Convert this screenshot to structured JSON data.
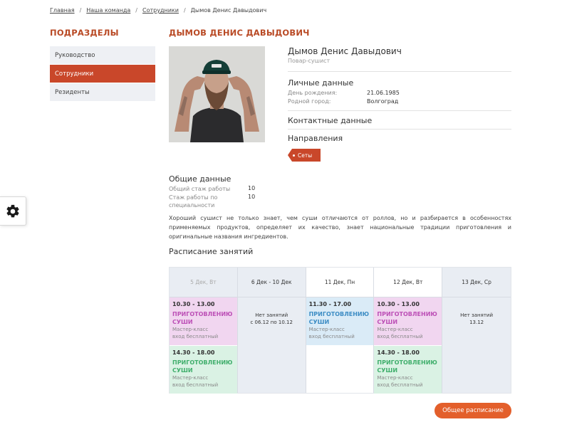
{
  "breadcrumb": {
    "items": [
      "Главная",
      "Наша команда",
      "Сотрудники"
    ],
    "current": "Дымов Денис Давыдович",
    "separator": "/"
  },
  "sidebar": {
    "title": "ПОДРАЗДЕЛЫ",
    "items": [
      {
        "label": "Руководство",
        "active": false
      },
      {
        "label": "Сотрудники",
        "active": true
      },
      {
        "label": "Резиденты",
        "active": false
      }
    ]
  },
  "profile": {
    "heading": "ДЫМОВ ДЕНИС ДАВЫДОВИЧ",
    "name": "Дымов Денис Давыдович",
    "role": "Повар-сушист",
    "personal": {
      "title": "Личные данные",
      "birthday_label": "День рождения:",
      "birthday_value": "21.06.1985",
      "city_label": "Родной город:",
      "city_value": "Волгоград"
    },
    "contacts_title": "Контактные данные",
    "directions_title": "Направления",
    "directions": [
      "Сеты"
    ],
    "general": {
      "title": "Общие данные",
      "total_label": "Общий стаж работы",
      "total_value": "10",
      "spec_label": "Стаж работы по специальности",
      "spec_value": "10"
    },
    "description": "Хороший сушист не только знает, чем суши отличаются от роллов, но и разбирается в особенностях применяемых продуктов, определяет их качество, знает национальные традиции приготовления и оригинальные названия ингредиентов."
  },
  "schedule": {
    "title": "Расписание занятий",
    "columns": [
      {
        "header": "5 Дек, Вт",
        "muted": true
      },
      {
        "header": "6 Дек - 10 Дек",
        "empty_line1": "Нет занятий",
        "empty_line2": "с 06.12 по 10.12"
      },
      {
        "header": "11 Дек, Пн"
      },
      {
        "header": "12 Дек, Вт"
      },
      {
        "header": "13 Дек, Ср",
        "empty_line1": "Нет занятий",
        "empty_line2": "13.12"
      }
    ],
    "events": {
      "c1_e1": {
        "time": "10.30 - 13.00",
        "name": "ПРИГОТОВЛЕНИЮ СУШИ",
        "kind": "Мастер-класс",
        "price": "вход бесплатный"
      },
      "c1_e2": {
        "time": "14.30 - 18.00",
        "name": "ПРИГОТОВЛЕНИЮ СУШИ",
        "kind": "Мастер-класс",
        "price": "вход бесплатный"
      },
      "c3_e1": {
        "time": "11.30 - 17.00",
        "name": "ПРИГОТОВЛЕНИЮ СУШИ",
        "kind": "Мастер-класс",
        "price": "вход бесплатный"
      },
      "c4_e1": {
        "time": "10.30 - 13.00",
        "name": "ПРИГОТОВЛЕНИЮ СУШИ",
        "kind": "Мастер-класс",
        "price": "вход бесплатный"
      },
      "c4_e2": {
        "time": "14.30 - 18.00",
        "name": "ПРИГОТОВЛЕНИЮ СУШИ",
        "kind": "Мастер-класс",
        "price": "вход бесплатный"
      }
    },
    "all_button": "Общее расписание"
  },
  "colors": {
    "accent": "#c9472a",
    "button": "#e35f2b",
    "event_purple": "#f1d6f0",
    "event_green": "#daf2e4",
    "event_blue": "#daebf7"
  },
  "icons": {
    "settings": "gear-icon"
  }
}
